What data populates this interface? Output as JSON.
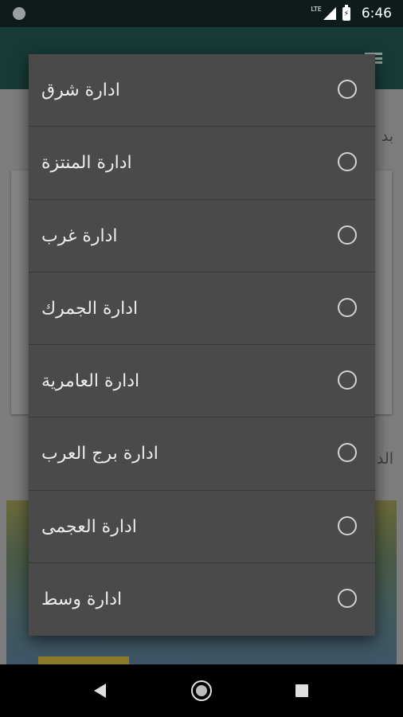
{
  "status_bar": {
    "network": "LTE",
    "time": "6:46",
    "icons": [
      "notification-dot-icon",
      "signal-icon",
      "battery-charging-icon"
    ]
  },
  "background": {
    "text1": "بد",
    "text2": "الد",
    "menu_icon": "hamburger-menu-icon"
  },
  "dialog": {
    "options": [
      {
        "label": "ادارة شرق",
        "selected": false
      },
      {
        "label": "ادارة المنتزة",
        "selected": false
      },
      {
        "label": "ادارة غرب",
        "selected": false
      },
      {
        "label": "ادارة الجمرك",
        "selected": false
      },
      {
        "label": "ادارة العامرية",
        "selected": false
      },
      {
        "label": "ادارة برج العرب",
        "selected": false
      },
      {
        "label": "ادارة العجمى",
        "selected": false
      },
      {
        "label": "ادارة وسط",
        "selected": false
      }
    ]
  },
  "nav_bar": {
    "icons": [
      "back-icon",
      "home-icon",
      "recent-apps-icon"
    ]
  }
}
